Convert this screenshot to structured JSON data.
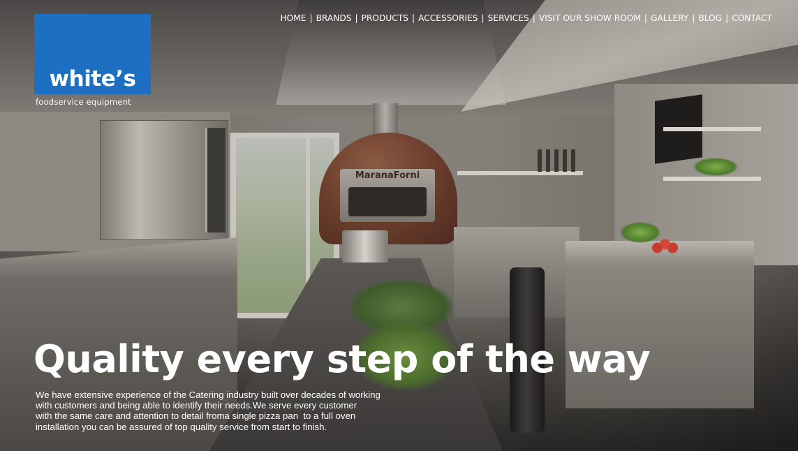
{
  "brand": {
    "logo_text": "white’s",
    "tagline": "foodservice equipment",
    "accent_color": "#1d6fc1"
  },
  "nav": {
    "separator": "|",
    "items": [
      {
        "label": "HOME"
      },
      {
        "label": "BRANDS"
      },
      {
        "label": "PRODUCTS"
      },
      {
        "label": "ACCESSORIES"
      },
      {
        "label": "SERVICES"
      },
      {
        "label": "VISIT OUR SHOW ROOM"
      },
      {
        "label": "GALLERY"
      },
      {
        "label": "BLOG"
      },
      {
        "label": "CONTACT"
      }
    ]
  },
  "hero": {
    "image_text": "MaranaForni",
    "headline": "Quality every step of the way",
    "intro_lines": [
      "We have extensive experience of the Catering industry built over decades of working",
      "with customers and being able to identify their needs.We serve every customer",
      "with the same care and attention to detail froma single pizza pan  to a full oven",
      "installation you can be assured of top quality service from start to finish."
    ]
  }
}
